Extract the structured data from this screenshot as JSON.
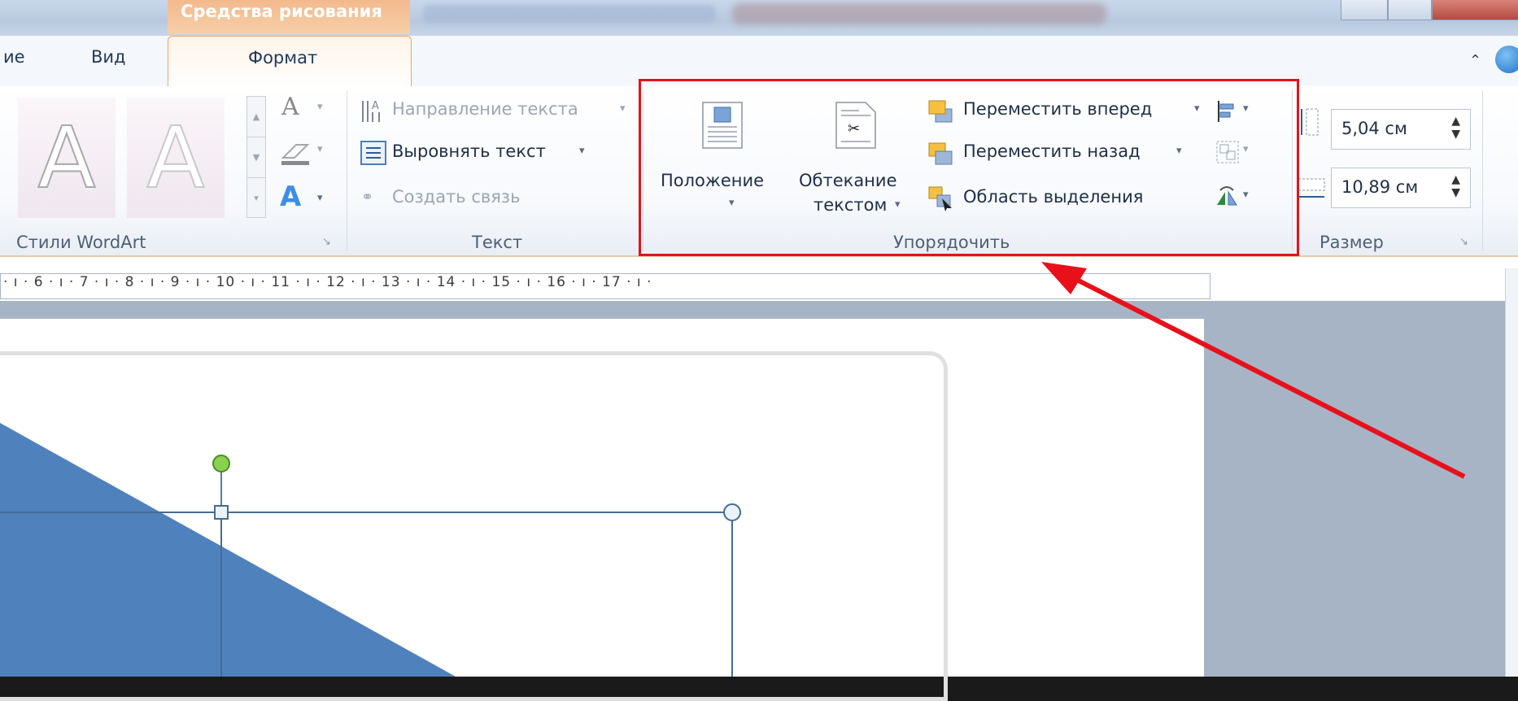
{
  "titlebar": {
    "context_tab_title": "Средства рисования"
  },
  "tabs": [
    {
      "label": "ие"
    },
    {
      "label": "Вид"
    }
  ],
  "active_tab": {
    "label": "Формат"
  },
  "ribbon": {
    "wordart": {
      "label": "Стили WordArt",
      "sample_glyph": "A"
    },
    "text": {
      "label": "Текст",
      "direction": "Направление текста",
      "align": "Выровнять текст",
      "link": "Создать связь"
    },
    "arrange": {
      "label": "Упорядочить",
      "position": "Положение",
      "wrap_line1": "Обтекание",
      "wrap_line2": "текстом",
      "bring_forward": "Переместить вперед",
      "send_backward": "Переместить назад",
      "selection_pane": "Область выделения"
    },
    "size": {
      "label": "Размер",
      "height": "5,04 см",
      "width": "10,89 см"
    }
  },
  "ruler": {
    "text": "· ı · 6 · ı · 7 · ı · 8 · ı · 9 · ı · 10 · ı · 11 · ı · 12 · ı · 13 · ı · 14 · ı · 15 · ı · 16 · ı · 17 · ı ·"
  },
  "colors": {
    "highlight": "#e8101a",
    "shape_fill": "#4f81bd",
    "ribbon_text": "#1e395b"
  }
}
